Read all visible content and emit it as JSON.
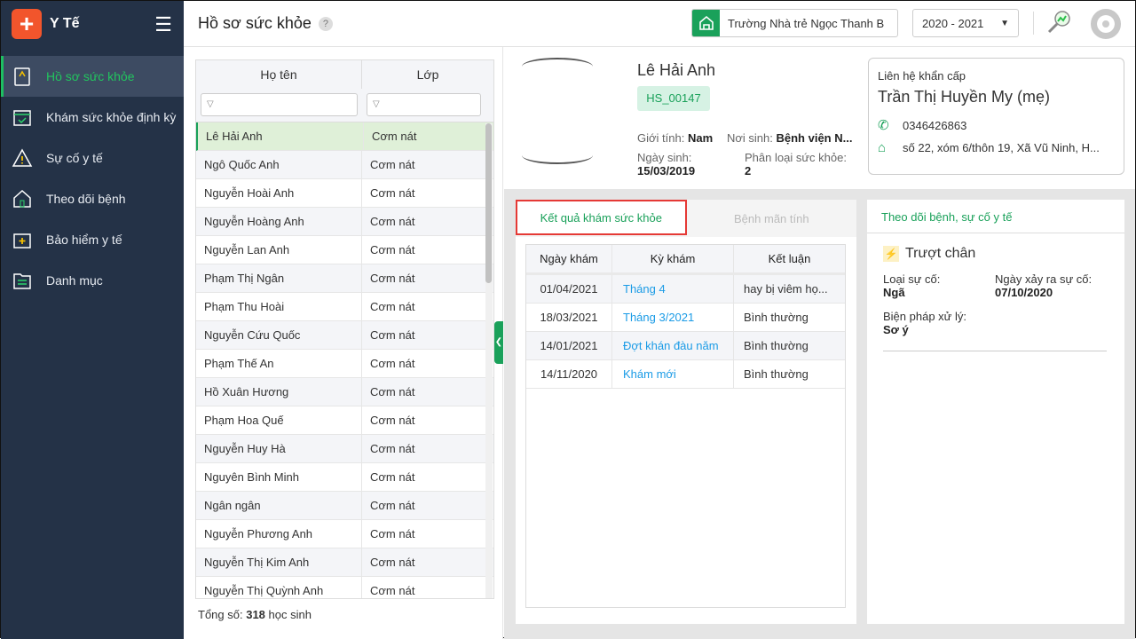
{
  "app": {
    "name": "Y Tế"
  },
  "sidebar": {
    "items": [
      {
        "label": "Hồ sơ sức khỏe",
        "icon": "clipboard-icon",
        "active": true
      },
      {
        "label": "Khám sức khỏe định kỳ",
        "icon": "calendar-check-icon"
      },
      {
        "label": "Sự cố y tế",
        "icon": "warning-icon"
      },
      {
        "label": "Theo dõi bệnh",
        "icon": "house-icon"
      },
      {
        "label": "Bảo hiểm y tế",
        "icon": "medical-bag-icon"
      },
      {
        "label": "Danh mục",
        "icon": "folder-icon"
      }
    ]
  },
  "header": {
    "title": "Hồ sơ sức khỏe",
    "help": "?",
    "school": "Trường Nhà trẻ Ngọc Thanh B",
    "year": "2020 - 2021"
  },
  "list": {
    "headers": [
      "Họ tên",
      "Lớp"
    ],
    "rows": [
      [
        "Lê Hải Anh",
        "Cơm nát"
      ],
      [
        "Ngô Quốc Anh",
        "Cơm nát"
      ],
      [
        "Nguyễn Hoài Anh",
        "Cơm nát"
      ],
      [
        "Nguyễn Hoàng Anh",
        "Cơm nát"
      ],
      [
        "Nguyễn Lan Anh",
        "Cơm nát"
      ],
      [
        "Phạm Thị Ngân",
        "Cơm nát"
      ],
      [
        "Phạm Thu Hoài",
        "Cơm nát"
      ],
      [
        "Nguyễn Cứu Quốc",
        "Cơm nát"
      ],
      [
        "Phạm Thế An",
        "Cơm nát"
      ],
      [
        "Hồ Xuân Hương",
        "Cơm nát"
      ],
      [
        "Phạm Hoa Quế",
        "Cơm nát"
      ],
      [
        "Nguyễn Huy Hà",
        "Cơm nát"
      ],
      [
        "Nguyên Bình Minh",
        "Cơm nát"
      ],
      [
        "Ngân ngân",
        "Cơm nát"
      ],
      [
        "Nguyễn Phương Anh",
        "Cơm nát"
      ],
      [
        "Nguyễn Thị Kim Anh",
        "Cơm nát"
      ],
      [
        "Nguyễn Thị Quỳnh Anh",
        "Cơm nát"
      ]
    ],
    "total_label": "Tổng số:",
    "total": "318",
    "total_unit": "học sinh"
  },
  "profile": {
    "name": "Lê Hải Anh",
    "code": "HS_00147",
    "gender_label": "Giới tính:",
    "gender": "Nam",
    "birthplace_label": "Nơi sinh:",
    "birthplace": "Bệnh viện N...",
    "dob_label": "Ngày sinh:",
    "dob": "15/03/2019",
    "health_label": "Phân loại sức khỏe:",
    "health": "2"
  },
  "contact": {
    "label": "Liên hệ khẩn cấp",
    "name": "Trần Thị Huyền My (mẹ)",
    "phone": "0346426863",
    "address": "số 22, xóm 6/thôn 19, Xã Vũ Ninh, H..."
  },
  "tabs": [
    "Kết quả khám sức khỏe",
    "Bệnh mãn tính"
  ],
  "exams": {
    "headers": [
      "Ngày khám",
      "Kỳ khám",
      "Kết luận"
    ],
    "rows": [
      [
        "01/04/2021",
        "Tháng 4",
        "hay bị viêm họ..."
      ],
      [
        "18/03/2021",
        "Tháng 3/2021",
        "Bình thường"
      ],
      [
        "14/01/2021",
        "Đợt khán đàu năm",
        "Bình thường"
      ],
      [
        "14/11/2020",
        "Khám mới",
        "Bình thường"
      ]
    ]
  },
  "incidents": {
    "title": "Theo dõi bệnh, sự cố y tế",
    "name": "Trượt chân",
    "type_label": "Loại sự cố:",
    "type": "Ngã",
    "date_label": "Ngày xảy ra sự cố:",
    "date": "07/10/2020",
    "action_label": "Biện pháp xử lý:",
    "action": "Sơ ý"
  }
}
